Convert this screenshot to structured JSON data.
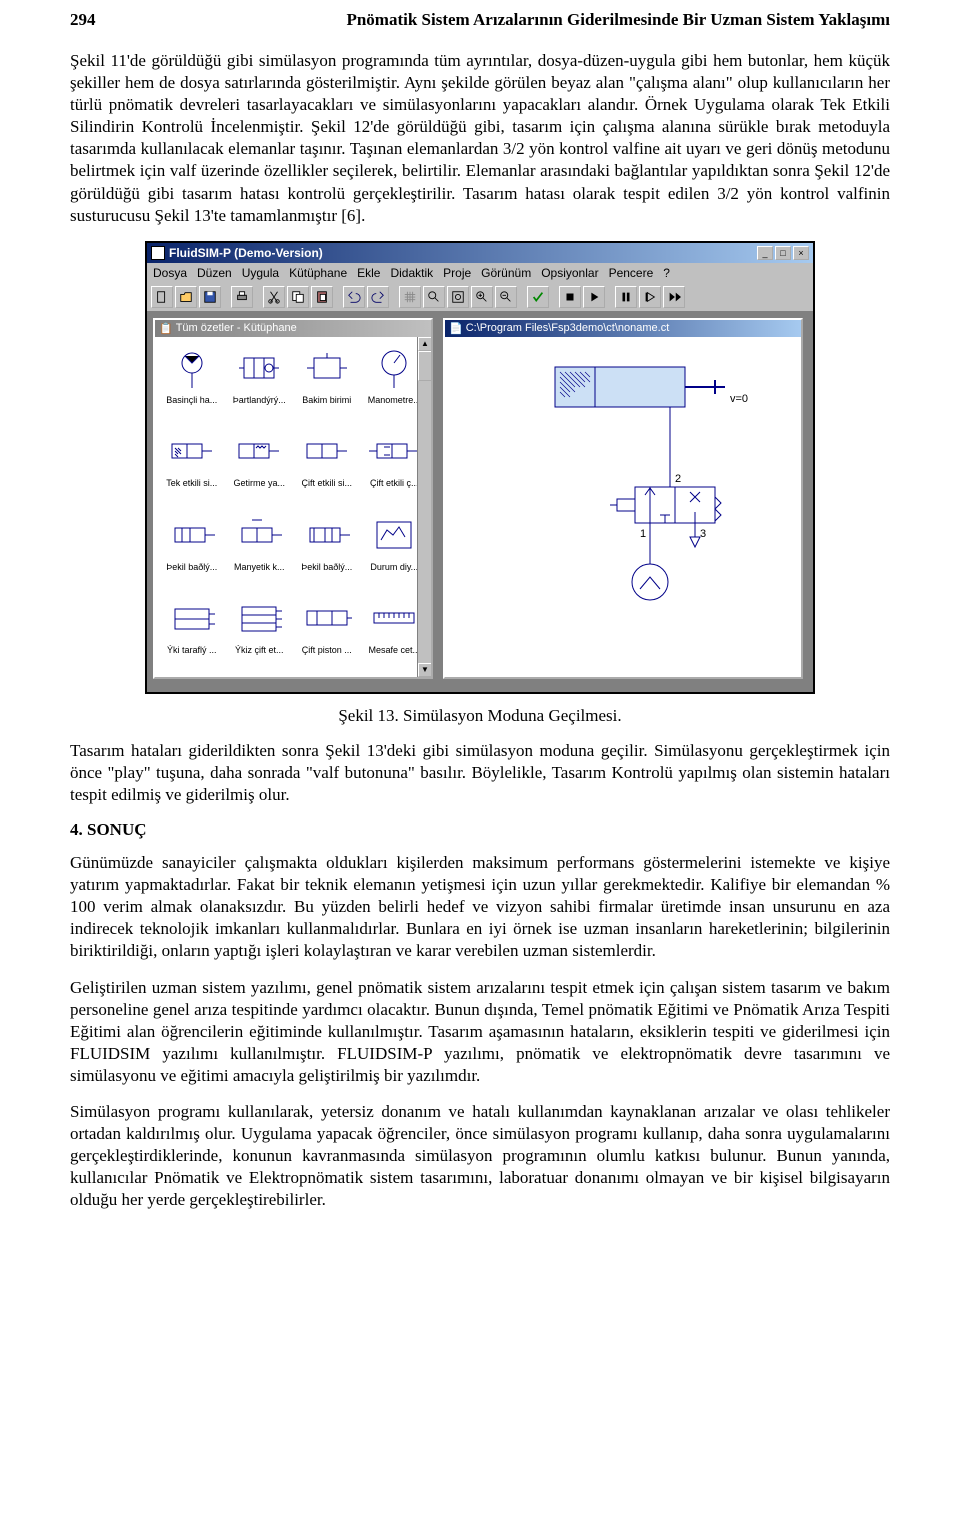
{
  "header": {
    "page_number": "294",
    "running_title": "Pnömatik Sistem Arızalarının Giderilmesinde Bir Uzman Sistem Yaklaşımı"
  },
  "paragraphs": {
    "p1": "Şekil 11'de görüldüğü gibi simülasyon programında tüm ayrıntılar, dosya-düzen-uygula gibi hem butonlar, hem küçük şekiller hem de dosya satırlarında gösterilmiştir. Aynı şekilde görülen beyaz alan \"çalışma alanı\" olup kullanıcıların her türlü pnömatik devreleri tasarlayacakları ve simülasyonlarını yapacakları alandır. Örnek Uygulama olarak Tek Etkili Silindirin Kontrolü İncelenmiştir. Şekil 12'de görüldüğü gibi, tasarım için çalışma alanına sürükle bırak metoduyla tasarımda kullanılacak elemanlar taşınır. Taşınan elemanlardan 3/2 yön kontrol valfine ait uyarı ve geri dönüş metodunu belirtmek için valf üzerinde özellikler seçilerek, belirtilir. Elemanlar arasındaki bağlantılar yapıldıktan sonra Şekil 12'de görüldüğü gibi tasarım hatası kontrolü gerçekleştirilir. Tasarım hatası olarak tespit edilen 3/2 yön kontrol valfinin susturucusu Şekil 13'te tamamlanmıştır [6].",
    "p2": "Tasarım hataları giderildikten sonra Şekil 13'deki gibi simülasyon moduna geçilir. Simülasyonu gerçekleştirmek için önce \"play\" tuşuna, daha sonrada \"valf butonuna\" basılır. Böylelikle, Tasarım Kontrolü yapılmış olan sistemin hataları tespit edilmiş ve giderilmiş olur.",
    "p3": "Günümüzde sanayiciler çalışmakta oldukları kişilerden maksimum performans göstermelerini istemekte ve kişiye yatırım yapmaktadırlar. Fakat bir teknik elemanın yetişmesi için uzun yıllar gerekmektedir. Kalifiye bir elemandan % 100 verim almak olanaksızdır. Bu yüzden belirli hedef ve vizyon sahibi firmalar üretimde insan unsurunu en aza indirecek teknolojik imkanları kullanmalıdırlar. Bunlara en iyi örnek ise uzman insanların hareketlerinin; bilgilerinin biriktirildiği, onların yaptığı işleri kolaylaştıran ve karar verebilen uzman sistemlerdir.",
    "p4": "Geliştirilen uzman sistem yazılımı, genel pnömatik sistem arızalarını tespit etmek için çalışan sistem tasarım ve bakım personeline genel arıza tespitinde yardımcı olacaktır. Bunun dışında, Temel pnömatik Eğitimi ve Pnömatik Arıza Tespiti Eğitimi alan öğrencilerin eğitiminde kullanılmıştır. Tasarım aşamasının hataların, eksiklerin tespiti ve giderilmesi için FLUIDSIM yazılımı kullanılmıştır. FLUIDSIM-P yazılımı, pnömatik ve elektropnömatik devre tasarımını ve simülasyonu ve eğitimi amacıyla geliştirilmiş bir yazılımdır.",
    "p5": "Simülasyon programı kullanılarak, yetersiz donanım ve hatalı kullanımdan kaynaklanan arızalar ve olası tehlikeler ortadan kaldırılmış olur. Uygulama yapacak öğrenciler, önce simülasyon programı kullanıp, daha sonra uygulamalarını gerçekleştirdiklerinde, konunun kavranmasında simülasyon programının olumlu katkısı bulunur. Bunun yanında, kullanıcılar Pnömatik ve Elektropnömatik sistem tasarımını, laboratuar donanımı olmayan ve bir kişisel bilgisayarın olduğu her yerde gerçekleştirebilirler."
  },
  "figure_caption": "Şekil 13. Simülasyon Moduna Geçilmesi.",
  "section_heading": "4. SONUÇ",
  "app": {
    "title": "FluidSIM-P (Demo-Version)",
    "menu": [
      "Dosya",
      "Düzen",
      "Uygula",
      "Kütüphane",
      "Ekle",
      "Didaktik",
      "Proje",
      "Görünüm",
      "Opsiyonlar",
      "Pencere",
      "?"
    ],
    "library_window_title": "Tüm özetler - Kütüphane",
    "canvas_window_title": "C:\\Program Files\\Fsp3demo\\ct\\noname.ct",
    "lib_items": [
      "Basinçli ha...",
      "Þartlandýrý...",
      "Bakim birimi",
      "Manometre...",
      "Tek etkili si...",
      "Getirme ya...",
      "Çift etkili si...",
      "Çift etkili ç...",
      "Þekil baðlý...",
      "Manyetik k...",
      "Þekil baðlý...",
      "Durum diy...",
      "Ýki taraflý ...",
      "Ýkiz çift et...",
      "Çift piston ...",
      "Mesafe cet..."
    ],
    "schematic": {
      "velocity_label": "v=0",
      "port_labels": [
        "1",
        "2",
        "3"
      ]
    }
  }
}
